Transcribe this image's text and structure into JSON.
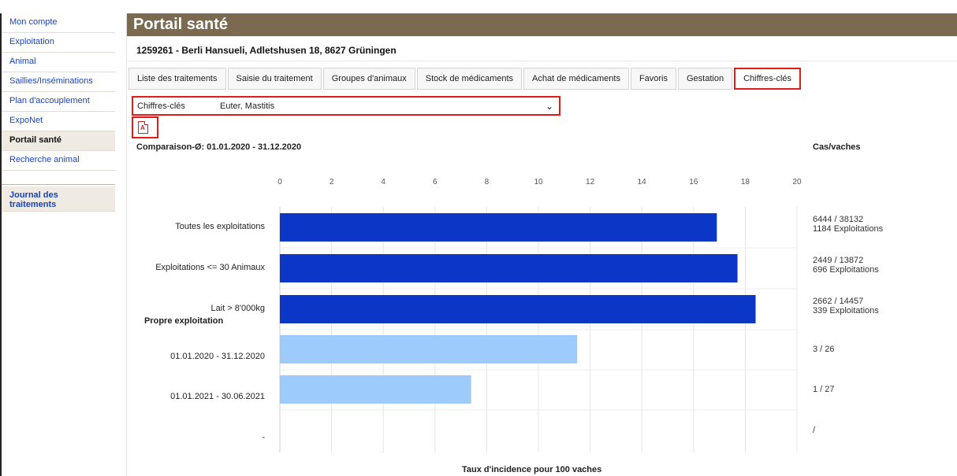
{
  "sidebar": {
    "items": [
      {
        "label": "Mon compte"
      },
      {
        "label": "Exploitation"
      },
      {
        "label": "Animal"
      },
      {
        "label": "Saillies/Inséminations"
      },
      {
        "label": "Plan d'accouplement"
      },
      {
        "label": "ExpoNet"
      },
      {
        "label": "Portail santé"
      },
      {
        "label": "Recherche animal"
      }
    ],
    "journal": "Journal des traitements"
  },
  "header": {
    "title": "Portail santé",
    "farm": "1259261 - Berli Hansueli, Adletshusen 18, 8627 Grüningen"
  },
  "tabs": [
    {
      "label": "Liste des traitements"
    },
    {
      "label": "Saisie du traitement"
    },
    {
      "label": "Groupes d'animaux"
    },
    {
      "label": "Stock de médicaments"
    },
    {
      "label": "Achat de médicaments"
    },
    {
      "label": "Favoris"
    },
    {
      "label": "Gestation"
    },
    {
      "label": "Chiffres-clés"
    }
  ],
  "selector": {
    "label": "Chiffres-clés",
    "value": "Euter, Mastitis"
  },
  "comparison": "Comparaison-Ø: 01.01.2020 - 31.12.2020",
  "cas_header": "Cas/vaches",
  "own_title": "Propre exploitation",
  "chart_data": {
    "type": "bar",
    "orientation": "horizontal",
    "xlabel": "Taux d'incidence pour 100 vaches",
    "xlim": [
      0,
      20
    ],
    "xticks": [
      0,
      2,
      4,
      6,
      8,
      10,
      12,
      14,
      16,
      18,
      20
    ],
    "grid": true,
    "categories": [
      "Toutes les exploitations",
      "Exploitations <= 30 Animaux",
      "Lait > 8'000kg",
      "01.01.2020 - 31.12.2020",
      "01.01.2021 - 30.06.2021",
      "-"
    ],
    "values": [
      16.9,
      17.7,
      18.4,
      11.5,
      7.4,
      0
    ],
    "colors": [
      "#0b36c6",
      "#0b36c6",
      "#0b36c6",
      "#9dcbfb",
      "#9dcbfb",
      "#9dcbfb"
    ],
    "annotations": [
      [
        "6444 / 38132",
        "1184 Exploitations"
      ],
      [
        "2449 / 13872",
        "696 Exploitations"
      ],
      [
        "2662 / 14457",
        "339 Exploitations"
      ],
      [
        "3 / 26"
      ],
      [
        "1 / 27"
      ],
      [
        "/"
      ]
    ]
  }
}
